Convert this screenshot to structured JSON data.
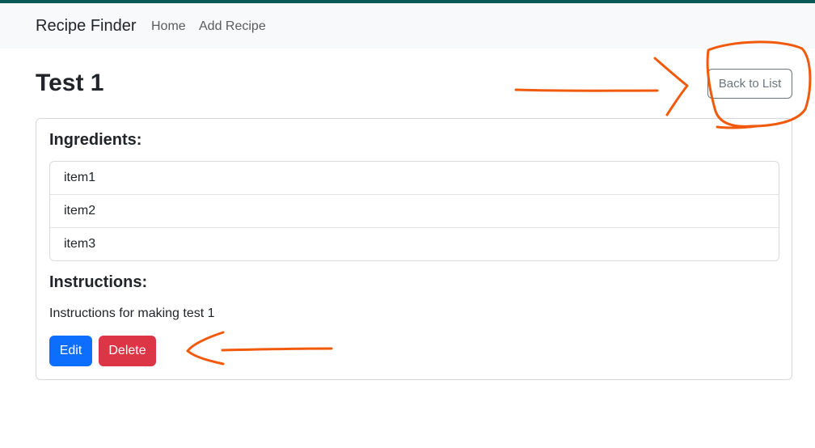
{
  "navbar": {
    "brand": "Recipe Finder",
    "links": [
      {
        "label": "Home"
      },
      {
        "label": "Add Recipe"
      }
    ]
  },
  "page": {
    "title": "Test 1",
    "back_button_label": "Back to List"
  },
  "card": {
    "ingredients_heading": "Ingredients:",
    "ingredients": [
      "item1",
      "item2",
      "item3"
    ],
    "instructions_heading": "Instructions:",
    "instructions_text": "Instructions for making test 1",
    "edit_label": "Edit",
    "delete_label": "Delete"
  },
  "colors": {
    "top_accent": "#0b5a57",
    "navbar_bg": "#f8f9fa",
    "primary": "#0d6efd",
    "danger": "#dc3545",
    "secondary": "#6c757d",
    "annotation": "#f15a0c"
  }
}
